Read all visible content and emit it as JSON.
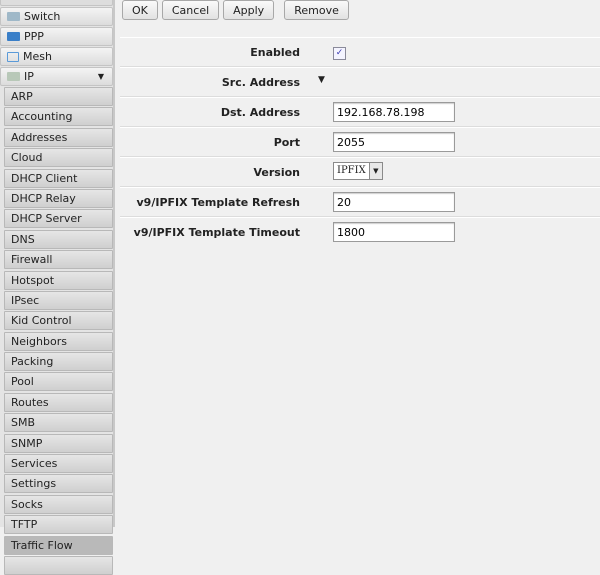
{
  "sidebar": {
    "top_items": [
      {
        "label": "Switch",
        "icon": "switch-icon"
      },
      {
        "label": "PPP",
        "icon": "ppp-icon"
      },
      {
        "label": "Mesh",
        "icon": "mesh-icon"
      },
      {
        "label": "IP",
        "icon": "ip-icon"
      }
    ],
    "ip_submenu": [
      "ARP",
      "Accounting",
      "Addresses",
      "Cloud",
      "DHCP Client",
      "DHCP Relay",
      "DHCP Server",
      "DNS",
      "Firewall",
      "Hotspot",
      "IPsec",
      "Kid Control",
      "Neighbors",
      "Packing",
      "Pool",
      "Routes",
      "SMB",
      "SNMP",
      "Services",
      "Settings",
      "Socks",
      "TFTP",
      "Traffic Flow",
      ""
    ],
    "active": "Traffic Flow"
  },
  "toolbar": {
    "ok": "OK",
    "cancel": "Cancel",
    "apply": "Apply",
    "remove": "Remove"
  },
  "form": {
    "enabled": {
      "label": "Enabled",
      "checked": true,
      "mark": "✓"
    },
    "src_address": {
      "label": "Src. Address"
    },
    "dst_address": {
      "label": "Dst. Address",
      "value": "192.168.78.198"
    },
    "port": {
      "label": "Port",
      "value": "2055"
    },
    "version": {
      "label": "Version",
      "value": "IPFIX"
    },
    "template_refresh": {
      "label": "v9/IPFIX Template Refresh",
      "value": "20"
    },
    "template_timeout": {
      "label": "v9/IPFIX Template Timeout",
      "value": "1800"
    }
  }
}
